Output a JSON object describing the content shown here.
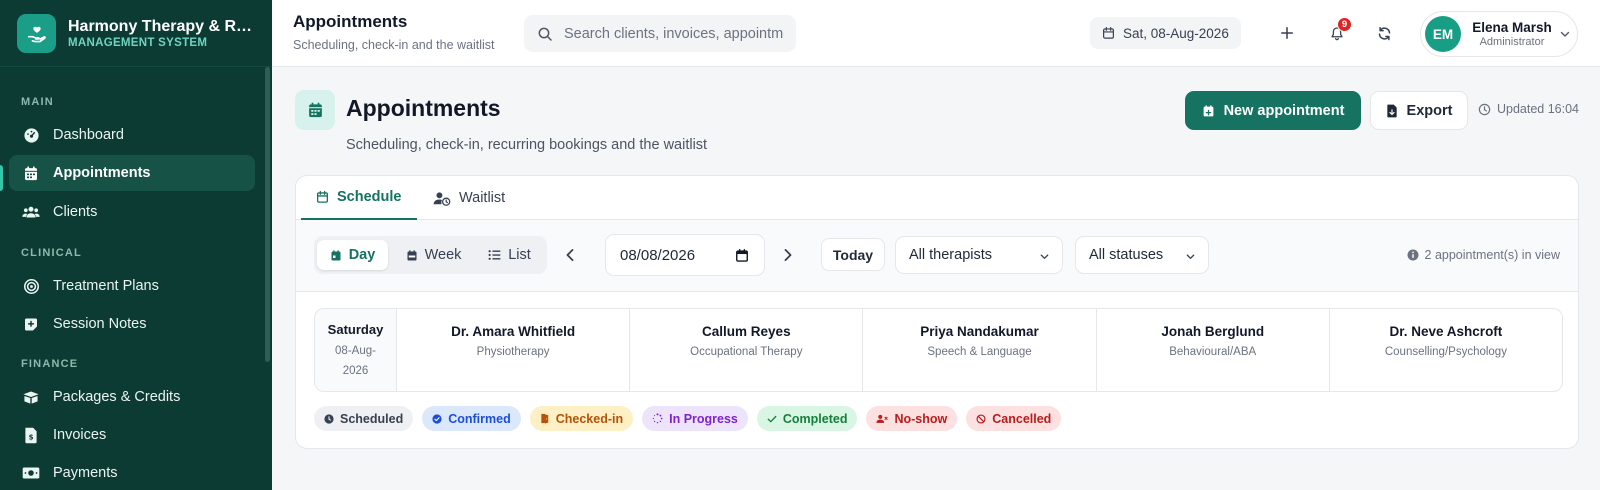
{
  "brand": {
    "title": "Harmony Therapy & Rehabilitation",
    "subtitle": "MANAGEMENT SYSTEM"
  },
  "sidebar": {
    "sections": [
      "MAIN",
      "CLINICAL",
      "FINANCE"
    ],
    "items": [
      {
        "label": "Dashboard",
        "icon": "dashboard-gauge-icon"
      },
      {
        "label": "Appointments",
        "icon": "calendar-icon",
        "active": true
      },
      {
        "label": "Clients",
        "icon": "users-icon"
      },
      {
        "label": "Treatment Plans",
        "icon": "target-icon"
      },
      {
        "label": "Session Notes",
        "icon": "note-plus-icon"
      },
      {
        "label": "Packages & Credits",
        "icon": "box-icon"
      },
      {
        "label": "Invoices",
        "icon": "invoice-icon"
      },
      {
        "label": "Payments",
        "icon": "money-icon"
      }
    ]
  },
  "header": {
    "title": "Appointments",
    "subtitle": "Scheduling, check-in and the waitlist",
    "search_placeholder": "Search clients, invoices, appointments...",
    "date": "Sat, 08-Aug-2026",
    "notifications": "9",
    "user": {
      "initials": "EM",
      "name": "Elena Marsh",
      "role": "Administrator"
    }
  },
  "page": {
    "title": "Appointments",
    "subtitle": "Scheduling, check-in, recurring bookings and the waitlist",
    "new_button": "New appointment",
    "export_button": "Export",
    "updated": "Updated 16:04"
  },
  "tabs": [
    "Schedule",
    "Waitlist"
  ],
  "toolbar": {
    "views": [
      "Day",
      "Week",
      "List"
    ],
    "date_value": "08/08/2026",
    "today": "Today",
    "therapist_filter": "All therapists",
    "status_filter": "All statuses",
    "in_view": "2 appointment(s) in view"
  },
  "schedule": {
    "day_name": "Saturday",
    "day_date": "08-Aug-2026",
    "therapists": [
      {
        "name": "Dr. Amara Whitfield",
        "specialty": "Physiotherapy"
      },
      {
        "name": "Callum Reyes",
        "specialty": "Occupational Therapy"
      },
      {
        "name": "Priya Nandakumar",
        "specialty": "Speech & Language"
      },
      {
        "name": "Jonah Berglund",
        "specialty": "Behavioural/ABA"
      },
      {
        "name": "Dr. Neve Ashcroft",
        "specialty": "Counselling/Psychology"
      }
    ]
  },
  "legend": [
    {
      "label": "Scheduled",
      "bg": "#eef0f3",
      "fg": "#374151"
    },
    {
      "label": "Confirmed",
      "bg": "#dbe7fb",
      "fg": "#1d4ed8"
    },
    {
      "label": "Checked-in",
      "bg": "#fdf0c4",
      "fg": "#b45309"
    },
    {
      "label": "In Progress",
      "bg": "#ede4fb",
      "fg": "#7e22ce"
    },
    {
      "label": "Completed",
      "bg": "#d9f5e3",
      "fg": "#15803d"
    },
    {
      "label": "No-show",
      "bg": "#fde0e0",
      "fg": "#b91c1c"
    },
    {
      "label": "Cancelled",
      "bg": "#fde0e0",
      "fg": "#b91c1c"
    }
  ],
  "colors": {
    "sidebar": "#0c3b33",
    "accent": "#167362",
    "accent_light": "#d7f2ec"
  }
}
